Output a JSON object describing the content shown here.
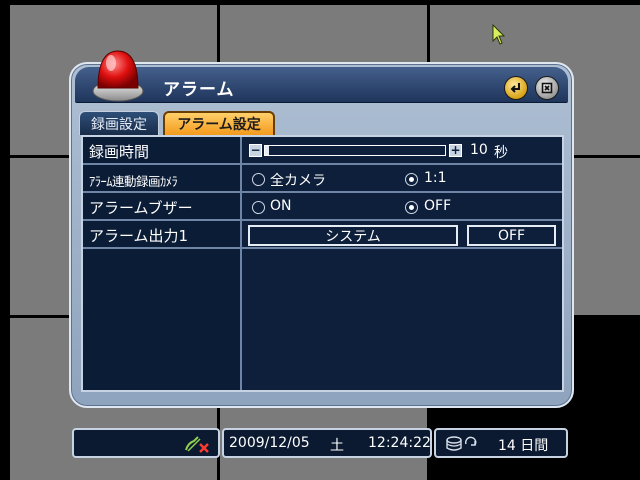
{
  "dialog": {
    "title": "アラーム",
    "icons": {
      "lamp": "alarm-lamp-icon",
      "enter": "enter-icon",
      "close": "close-icon"
    }
  },
  "tabs": [
    {
      "label": "録画設定",
      "active": false
    },
    {
      "label": "アラーム設定",
      "active": true
    }
  ],
  "settings": {
    "record_time": {
      "label": "録画時間",
      "value": "10",
      "unit": "秒",
      "slider_fraction": 0.02
    },
    "alarm_camera": {
      "label": "ｱﾗｰﾑ連動録画ｶﾒﾗ",
      "option_all": "全カメラ",
      "option_one": "1:1",
      "selected": "1:1"
    },
    "alarm_buzzer": {
      "label": "アラームブザー",
      "option_on": "ON",
      "option_off": "OFF",
      "selected": "OFF"
    },
    "alarm_output": {
      "label": "アラーム出力1",
      "mode": "システム",
      "state": "OFF"
    }
  },
  "status_bar": {
    "mute_icon": "speaker-mute-icon",
    "date": "2009/12/05",
    "weekday": "土",
    "time": "12:24:22",
    "hdd_icon": "hdd-overwrite-icon",
    "days_remaining": "14 日間"
  },
  "colors": {
    "tab_active": "#f39a1c",
    "panel": "#0d1f3a",
    "title_bar": "#1f355c"
  }
}
